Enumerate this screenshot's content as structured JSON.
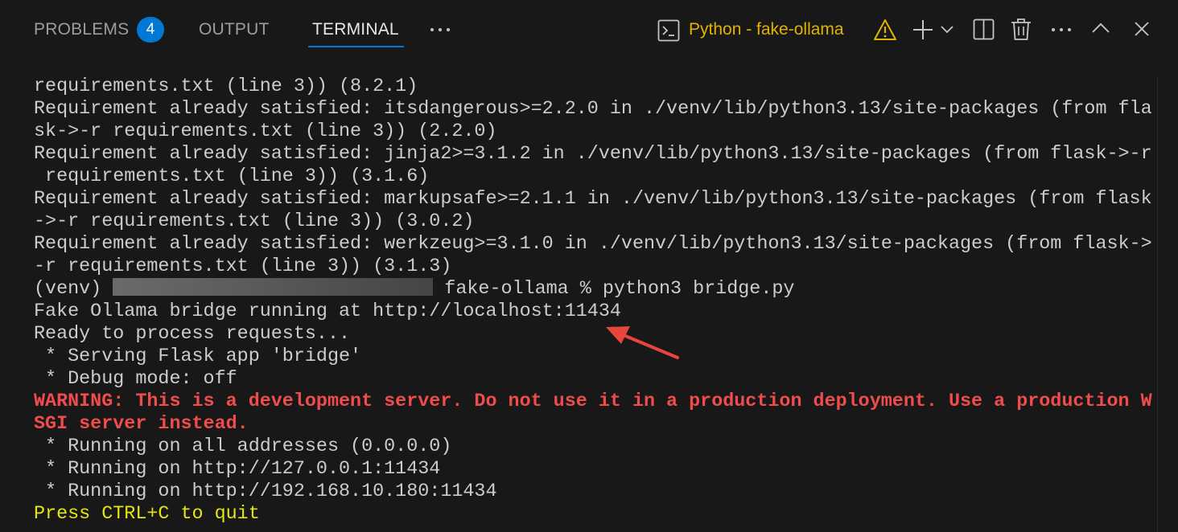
{
  "tabs": [
    {
      "label": "PROBLEMS",
      "badge": "4"
    },
    {
      "label": "OUTPUT"
    },
    {
      "label": "TERMINAL",
      "active": true
    }
  ],
  "toolbar": {
    "more_tabs_icon": "ellipsis-icon",
    "terminal_icon": "terminal-icon",
    "terminal_name": "Python - fake-ollama",
    "warning_icon": "warning-icon",
    "add_icon": "plus-icon",
    "dropdown_icon": "chevron-down-icon",
    "split_icon": "split-icon",
    "trash_icon": "trash-icon",
    "more_icon": "ellipsis-icon",
    "maximize_icon": "chevron-up-icon",
    "close_icon": "close-icon"
  },
  "colors": {
    "background": "#181818",
    "accent": "#0078d4",
    "warning_title": "#e1b300",
    "error_text": "#f14c4c",
    "yellow_text": "#e5e510",
    "arrow": "#e8453c"
  },
  "terminal": {
    "lines": [
      "requirements.txt (line 3)) (8.2.1)",
      "Requirement already satisfied: itsdangerous>=2.2.0 in ./venv/lib/python3.13/site-packages (from fla",
      "sk->-r requirements.txt (line 3)) (2.2.0)",
      "Requirement already satisfied: jinja2>=3.1.2 in ./venv/lib/python3.13/site-packages (from flask->-r",
      " requirements.txt (line 3)) (3.1.6)",
      "Requirement already satisfied: markupsafe>=2.1.1 in ./venv/lib/python3.13/site-packages (from flask",
      "->-r requirements.txt (line 3)) (3.0.2)",
      "Requirement already satisfied: werkzeug>=3.1.0 in ./venv/lib/python3.13/site-packages (from flask->",
      "-r requirements.txt (line 3)) (3.1.3)"
    ],
    "prompt_prefix": "(venv) ",
    "prompt_suffix": " fake-ollama % python3 bridge.py",
    "output_lines": [
      "Fake Ollama bridge running at http://localhost:11434",
      "Ready to process requests...",
      " * Serving Flask app 'bridge'",
      " * Debug mode: off"
    ],
    "warning_lines": [
      "WARNING: This is a development server. Do not use it in a production deployment. Use a production W",
      "SGI server instead."
    ],
    "running_lines": [
      " * Running on all addresses (0.0.0.0)",
      " * Running on http://127.0.0.1:11434",
      " * Running on http://192.168.10.180:11434"
    ],
    "quit_line": "Press CTRL+C to quit"
  }
}
